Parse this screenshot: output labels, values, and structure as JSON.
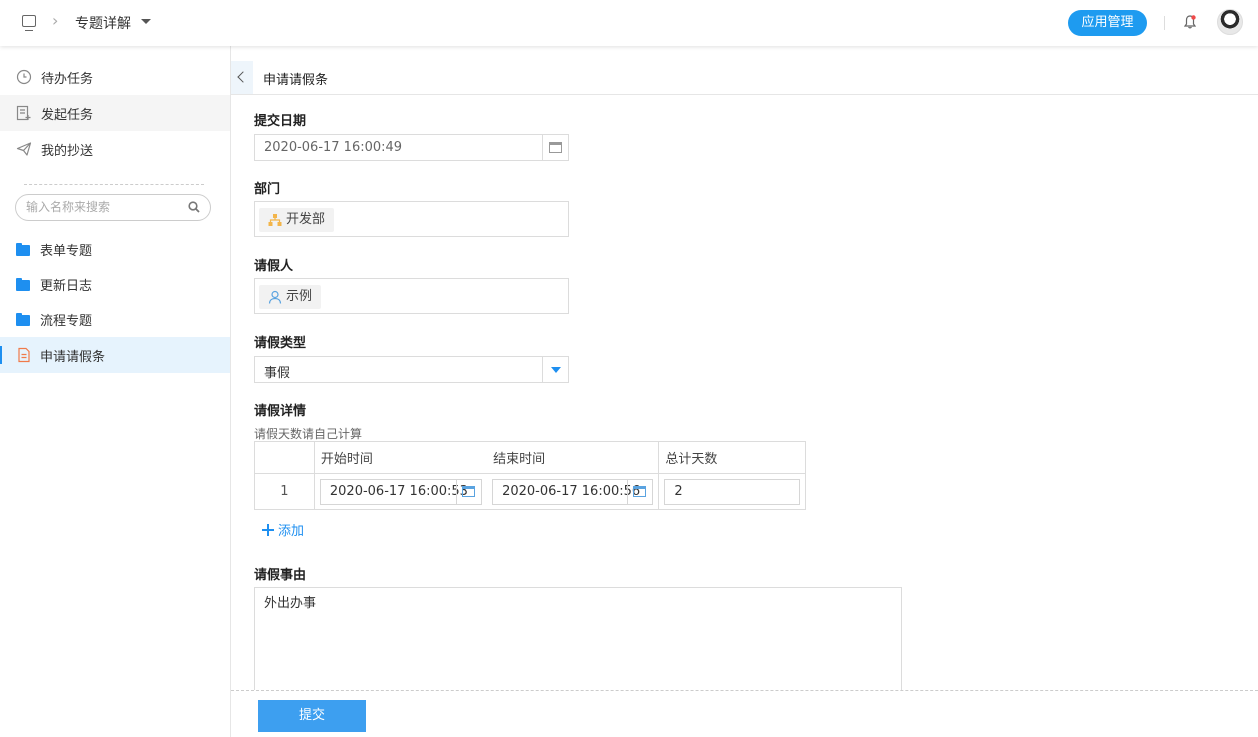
{
  "header": {
    "title": "专题详解",
    "app_manage_label": "应用管理"
  },
  "sidebar": {
    "nav": [
      {
        "label": "待办任务",
        "icon": "clock-icon"
      },
      {
        "label": "发起任务",
        "icon": "start-task-icon"
      },
      {
        "label": "我的抄送",
        "icon": "send-icon"
      }
    ],
    "search_placeholder": "输入名称来搜索",
    "folders": [
      {
        "label": "表单专题",
        "icon": "folder-icon"
      },
      {
        "label": "更新日志",
        "icon": "folder-icon"
      },
      {
        "label": "流程专题",
        "icon": "folder-icon"
      },
      {
        "label": "申请请假条",
        "icon": "form-document-icon"
      }
    ],
    "accent_color": "#1e8ff0"
  },
  "main": {
    "tab_title": "申请请假条",
    "fields": {
      "submit_date": {
        "label": "提交日期",
        "value": "2020-06-17 16:00:49"
      },
      "department": {
        "label": "部门",
        "value": "开发部"
      },
      "applicant": {
        "label": "请假人",
        "value": "示例"
      },
      "leave_type": {
        "label": "请假类型",
        "value": "事假"
      },
      "details": {
        "label": "请假详情",
        "hint": "请假天数请自己计算",
        "columns": [
          "开始时间",
          "结束时间",
          "总计天数"
        ],
        "rows": [
          {
            "index": "1",
            "start": "2020-06-17 16:00:53",
            "end": "2020-06-17 16:00:56",
            "days": "2"
          }
        ],
        "add_label": "添加"
      },
      "reason": {
        "label": "请假事由",
        "value": "外出办事"
      }
    },
    "submit_label": "提交"
  }
}
